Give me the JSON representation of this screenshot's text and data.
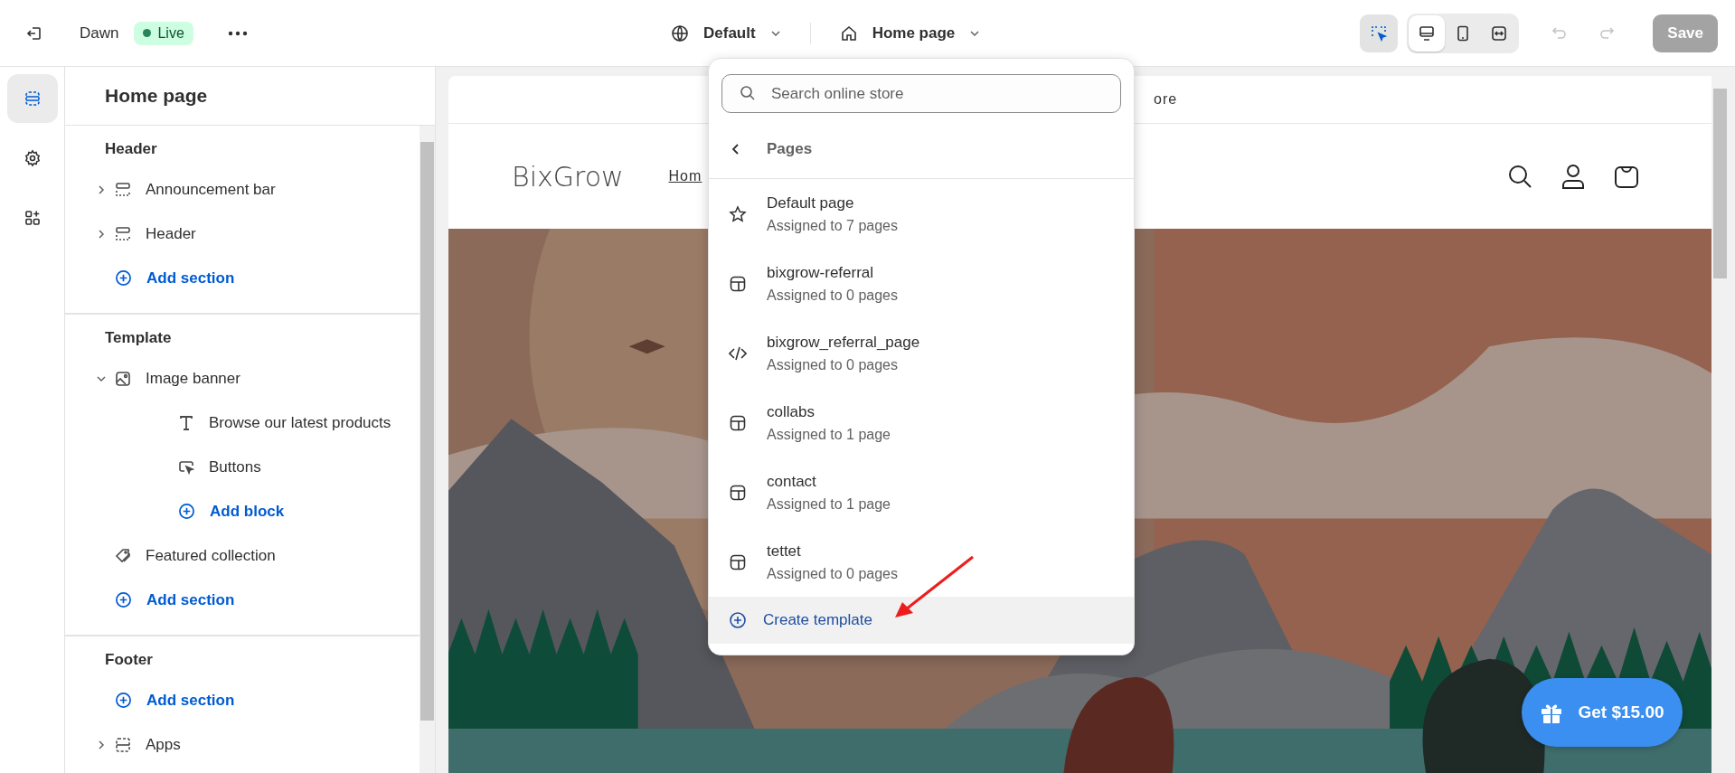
{
  "topbar": {
    "theme_name": "Dawn",
    "status_badge": "Live",
    "theme_selector": "Default",
    "page_selector": "Home page",
    "inspector_on": true,
    "viewports": [
      {
        "kind": "desktop",
        "selected": true
      },
      {
        "kind": "mobile",
        "selected": false
      },
      {
        "kind": "fullwidth",
        "selected": false
      }
    ],
    "save_button": {
      "label": "Save",
      "disabled": true
    }
  },
  "rail": [
    {
      "kind": "sections",
      "selected": true
    },
    {
      "kind": "settings",
      "selected": false
    },
    {
      "kind": "apps",
      "selected": false
    }
  ],
  "panel": {
    "title": "Home page",
    "groups": [
      {
        "title": "Header",
        "items": [
          {
            "kind": "bar",
            "label": "Announcement bar",
            "expanded": false
          },
          {
            "kind": "bar",
            "label": "Header",
            "expanded": false
          },
          {
            "kind": "add",
            "label": "Add section"
          }
        ]
      },
      {
        "title": "Template",
        "items": [
          {
            "kind": "banner",
            "label": "Image banner",
            "expanded": true,
            "children": [
              {
                "kind": "text",
                "label": "Browse our latest products"
              },
              {
                "kind": "buttons",
                "label": "Buttons"
              },
              {
                "kind": "add",
                "label": "Add block"
              }
            ]
          },
          {
            "kind": "collection",
            "label": "Featured collection"
          },
          {
            "kind": "add",
            "label": "Add section"
          }
        ]
      },
      {
        "title": "Footer",
        "items": [
          {
            "kind": "add",
            "label": "Add section"
          },
          {
            "kind": "apps",
            "label": "Apps",
            "expanded": false
          }
        ]
      }
    ]
  },
  "preview": {
    "announcement": "ore",
    "store_name": "BixGrow",
    "nav_link": "Hom",
    "gift_button": "Get $15.00"
  },
  "dropdown": {
    "search": {
      "placeholder": "Search online store"
    },
    "back_label": "Pages",
    "items": [
      {
        "kind": "default",
        "name": "Default page",
        "subtitle": "Assigned to 7 pages"
      },
      {
        "kind": "template",
        "name": "bixgrow-referral",
        "subtitle": "Assigned to 0 pages"
      },
      {
        "kind": "code",
        "name": "bixgrow_referral_page",
        "subtitle": "Assigned to 0 pages"
      },
      {
        "kind": "template",
        "name": "collabs",
        "subtitle": "Assigned to 1 page"
      },
      {
        "kind": "template",
        "name": "contact",
        "subtitle": "Assigned to 1 page"
      },
      {
        "kind": "template",
        "name": "tettet",
        "subtitle": "Assigned to 0 pages"
      }
    ],
    "create_action": {
      "label": "Create template",
      "hovered": true
    }
  }
}
